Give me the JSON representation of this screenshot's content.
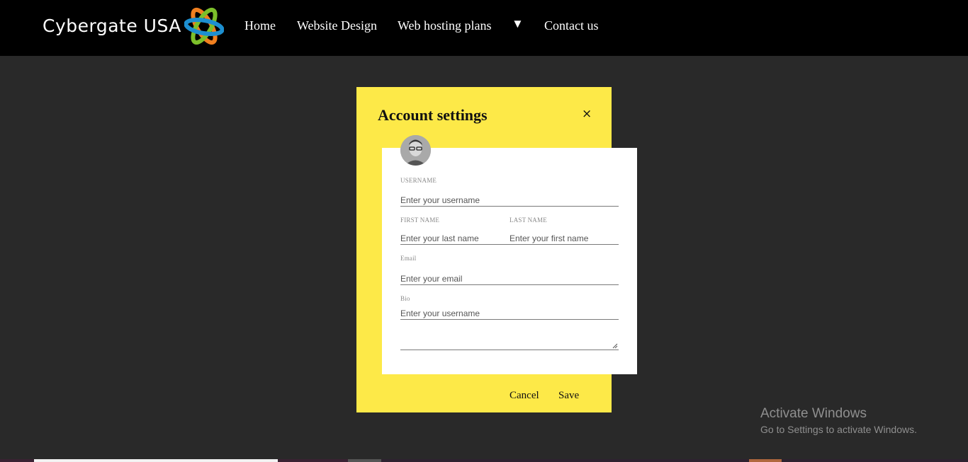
{
  "header": {
    "brand": "Cybergate USA",
    "nav": {
      "home": "Home",
      "website_design": "Website Design",
      "web_hosting": "Web hosting plans",
      "dropdown_caret": "▼",
      "contact": "Contact us"
    }
  },
  "modal": {
    "title": "Account settings",
    "close_label": "×",
    "fields": {
      "username": {
        "label": "USERNAME",
        "placeholder": "Enter your username"
      },
      "first_name": {
        "label": "FIRST NAME",
        "placeholder": "Enter your last name"
      },
      "last_name": {
        "label": "LAST NAME",
        "placeholder": "Enter your first name"
      },
      "email": {
        "label": "Email",
        "placeholder": "Enter your email"
      },
      "bio": {
        "label": "Bio",
        "placeholder": "Enter your username"
      }
    },
    "actions": {
      "cancel": "Cancel",
      "save": "Save"
    }
  },
  "watermark": {
    "title": "Activate Windows",
    "subtitle": "Go to Settings to activate Windows."
  },
  "colors": {
    "page_bg": "#292929",
    "topbar_bg": "#000000",
    "modal_bg": "#fde948",
    "card_bg": "#ffffff"
  },
  "icons": [
    "logo-icon",
    "close-icon",
    "avatar-image",
    "dropdown-caret-icon",
    "resize-grip-icon"
  ]
}
